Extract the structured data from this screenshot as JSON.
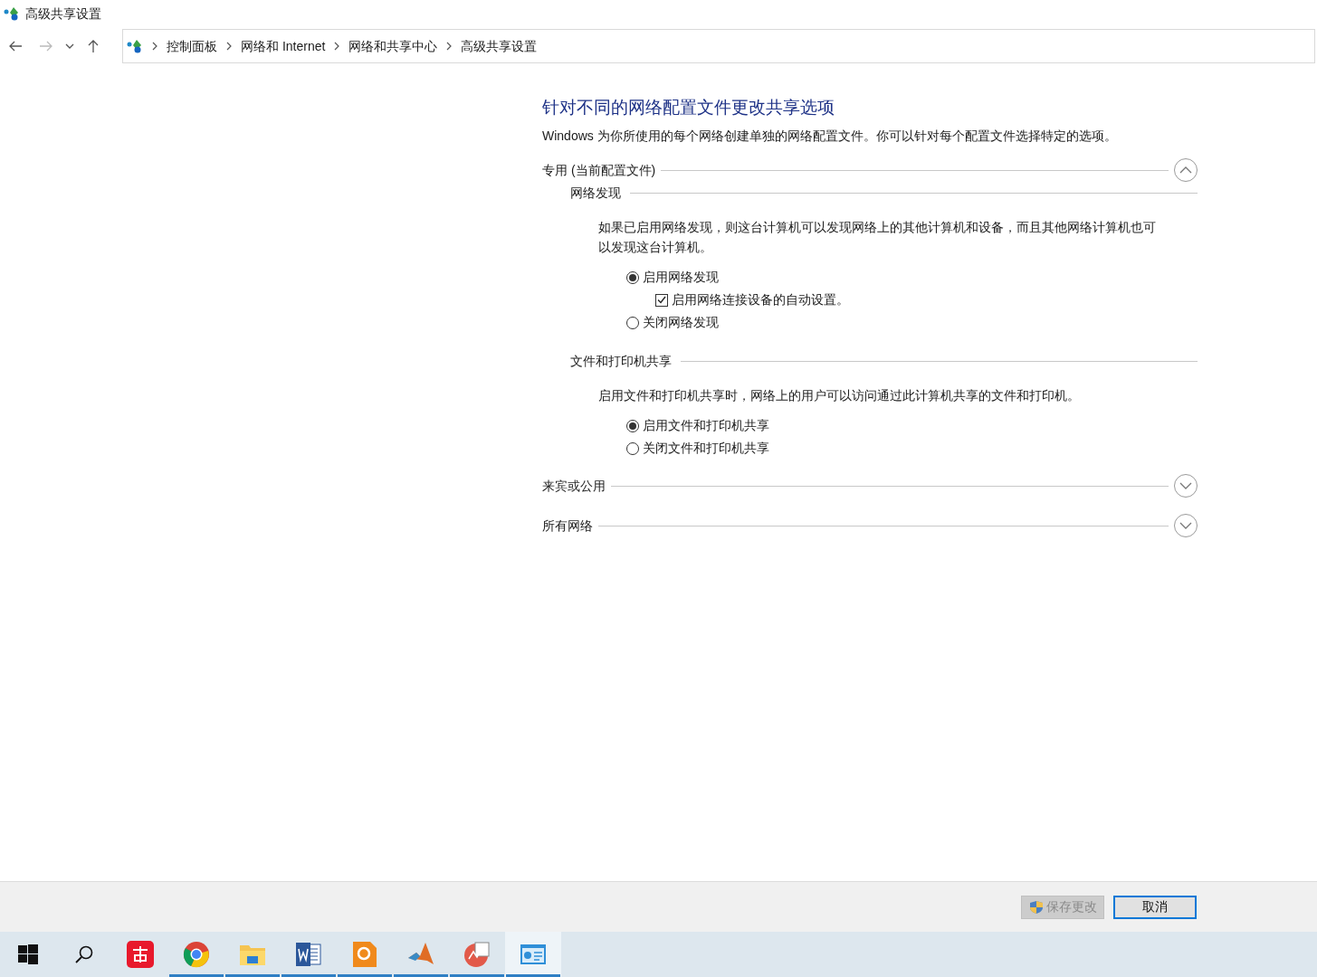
{
  "window": {
    "title": "高级共享设置"
  },
  "address_bar": {
    "crumbs": [
      "控制面板",
      "网络和 Internet",
      "网络和共享中心",
      "高级共享设置"
    ]
  },
  "heading": "针对不同的网络配置文件更改共享选项",
  "intro": "Windows 为你所使用的每个网络创建单独的网络配置文件。你可以针对每个配置文件选择特定的选项。",
  "profiles": [
    {
      "label": "专用 (当前配置文件)",
      "expanded": true,
      "groups": [
        {
          "title": "网络发现",
          "description": "如果已启用网络发现，则这台计算机可以发现网络上的其他计算机和设备，而且其他网络计算机也可以发现这台计算机。",
          "options": [
            {
              "label": "启用网络发现",
              "selected": true,
              "sub": {
                "label": "启用网络连接设备的自动设置。",
                "checked": true
              }
            },
            {
              "label": "关闭网络发现",
              "selected": false
            }
          ]
        },
        {
          "title": "文件和打印机共享",
          "description": "启用文件和打印机共享时，网络上的用户可以访问通过此计算机共享的文件和打印机。",
          "options": [
            {
              "label": "启用文件和打印机共享",
              "selected": true
            },
            {
              "label": "关闭文件和打印机共享",
              "selected": false
            }
          ]
        }
      ]
    },
    {
      "label": "来宾或公用",
      "expanded": false
    },
    {
      "label": "所有网络",
      "expanded": false
    }
  ],
  "buttons": [
    {
      "label": "保存更改",
      "kind": "shield",
      "disabled": true
    },
    {
      "label": "取消",
      "kind": "plain",
      "disabled": false
    }
  ],
  "taskbar": [
    {
      "kind": "start",
      "running": false,
      "active": false
    },
    {
      "kind": "search",
      "running": false,
      "active": false
    },
    {
      "kind": "dict",
      "running": false,
      "active": false
    },
    {
      "kind": "browser",
      "running": true,
      "active": false
    },
    {
      "kind": "folder",
      "running": true,
      "active": false
    },
    {
      "kind": "word",
      "running": true,
      "active": false
    },
    {
      "kind": "pdf",
      "running": true,
      "active": false
    },
    {
      "kind": "matlab",
      "running": true,
      "active": false
    },
    {
      "kind": "chart",
      "running": true,
      "active": false
    },
    {
      "kind": "panel",
      "running": true,
      "active": true
    }
  ]
}
